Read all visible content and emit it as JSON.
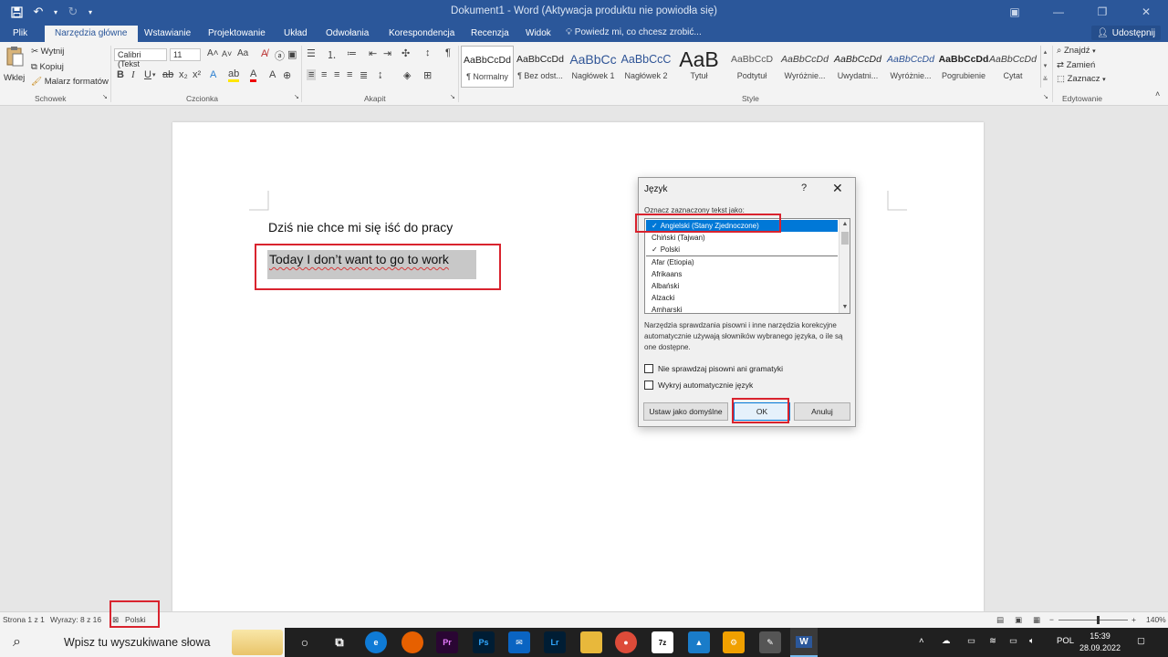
{
  "window": {
    "title": "Dokument1 - Word (Aktywacja produktu nie powiodła się)",
    "qat": {
      "save_icon": "save-icon",
      "undo_icon": "undo-icon",
      "redo_icon": "redo-icon",
      "customize_icon": "chevron-down-icon"
    }
  },
  "tabs": [
    {
      "label": "Plik"
    },
    {
      "label": "Narzędzia główne"
    },
    {
      "label": "Wstawianie"
    },
    {
      "label": "Projektowanie"
    },
    {
      "label": "Układ"
    },
    {
      "label": "Odwołania"
    },
    {
      "label": "Korespondencja"
    },
    {
      "label": "Recenzja"
    },
    {
      "label": "Widok"
    }
  ],
  "tellme": "Powiedz mi, co chcesz zrobić...",
  "share": "Udostępnij",
  "ribbon": {
    "clipboard": {
      "paste": "Wklej",
      "cut": "Wytnij",
      "copy": "Kopiuj",
      "painter": "Malarz formatów",
      "label": "Schowek"
    },
    "font": {
      "name": "Calibri (Tekst",
      "size": "11",
      "label": "Czcionka"
    },
    "paragraph": {
      "label": "Akapit"
    },
    "styles": {
      "label": "Style",
      "items": [
        {
          "preview": "AaBbCcDd",
          "name": "¶ Normalny"
        },
        {
          "preview": "AaBbCcDd",
          "name": "¶ Bez odst..."
        },
        {
          "preview": "AaBbCc",
          "name": "Nagłówek 1"
        },
        {
          "preview": "AaBbCcC",
          "name": "Nagłówek 2"
        },
        {
          "preview": "AaB",
          "name": "Tytuł"
        },
        {
          "preview": "AaBbCcD",
          "name": "Podtytuł"
        },
        {
          "preview": "AaBbCcDd",
          "name": "Wyróżnie..."
        },
        {
          "preview": "AaBbCcDd",
          "name": "Uwydatni..."
        },
        {
          "preview": "AaBbCcDd",
          "name": "Wyróżnie..."
        },
        {
          "preview": "AaBbCcDd",
          "name": "Pogrubienie"
        },
        {
          "preview": "AaBbCcDd",
          "name": "Cytat"
        }
      ]
    },
    "editing": {
      "find": "Znajdź",
      "replace": "Zamień",
      "select": "Zaznacz",
      "label": "Edytowanie"
    }
  },
  "document": {
    "line1": "Dziś nie chce mi się iść do pracy",
    "line2": "Today I don’t want to go to work"
  },
  "dialog": {
    "title": "Język",
    "help": "?",
    "close": "✕",
    "label": "Oznacz zaznaczony tekst jako:",
    "languages": [
      {
        "name": "Angielski (Stany Zjednoczone)",
        "checked": true,
        "selected": true
      },
      {
        "name": "Chiński (Tajwan)",
        "checked": false,
        "selected": false
      },
      {
        "name": "Polski",
        "checked": true,
        "selected": false
      },
      {
        "name": "Afar (Etiopia)",
        "checked": false,
        "selected": false
      },
      {
        "name": "Afrikaans",
        "checked": false,
        "selected": false
      },
      {
        "name": "Albański",
        "checked": false,
        "selected": false
      },
      {
        "name": "Alzacki",
        "checked": false,
        "selected": false
      },
      {
        "name": "Amharski",
        "checked": false,
        "selected": false
      }
    ],
    "description": "Narzędzia sprawdzania pisowni i inne narzędzia korekcyjne automatycznie używają słowników wybranego języka, o ile są one dostępne.",
    "checkbox_nospell": "Nie sprawdzaj pisowni ani gramatyki",
    "checkbox_autodetect": "Wykryj automatycznie język",
    "btn_default": "Ustaw jako domyślne",
    "btn_ok": "OK",
    "btn_cancel": "Anuluj"
  },
  "status": {
    "page": "Strona 1 z 1",
    "words": "Wyrazy: 8 z 16",
    "language": "Polski",
    "zoom": "140%"
  },
  "taskbar": {
    "search_placeholder": "Wpisz tu wyszukiwane słowa",
    "tray_lang": "POL",
    "time": "15:39",
    "date": "28.09.2022"
  }
}
